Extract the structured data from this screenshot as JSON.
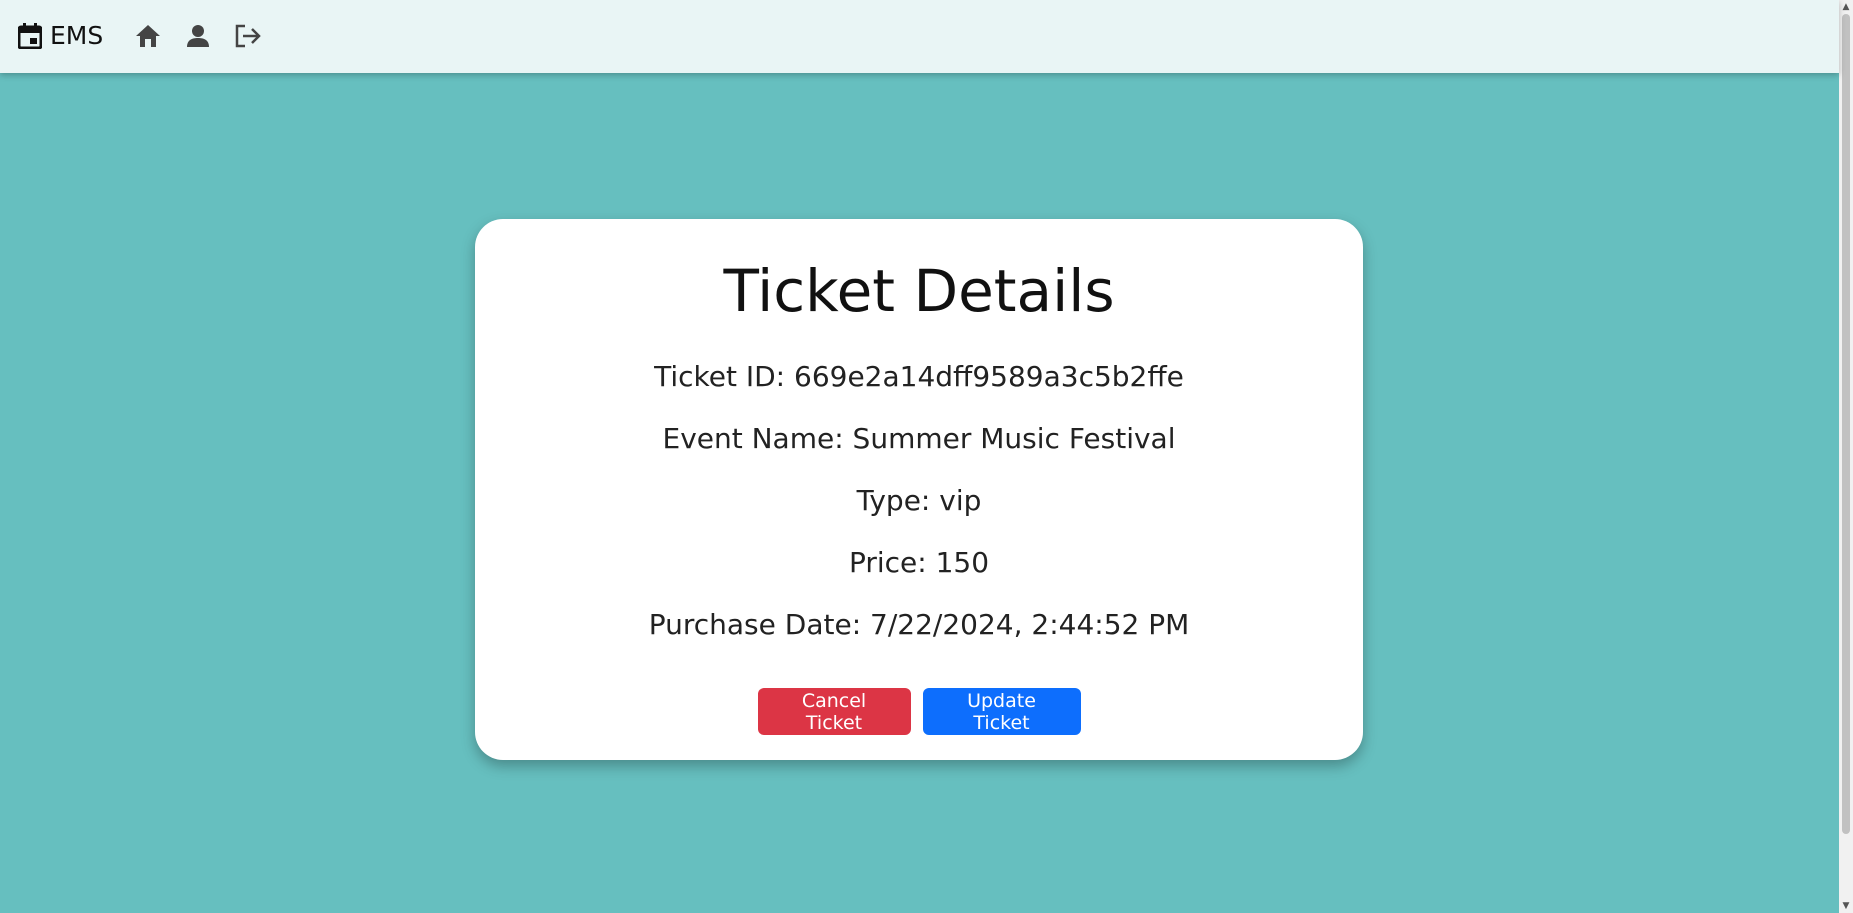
{
  "navbar": {
    "brand_text": "EMS",
    "brand_icon": "calendar-icon",
    "icons": [
      "home-icon",
      "user-icon",
      "logout-icon"
    ]
  },
  "card": {
    "title": "Ticket Details",
    "ticket_id": "Ticket ID: 669e2a14dff9589a3c5b2ffe",
    "event_name": "Event Name: Summer Music Festival",
    "type": "Type: vip",
    "price": "Price: 150",
    "purchase_date": "Purchase Date: 7/22/2024, 2:44:52 PM",
    "cancel_label": "Cancel Ticket",
    "update_label": "Update Ticket"
  },
  "colors": {
    "background": "#66bfbf",
    "navbar": "#e9f5f5",
    "cancel_button": "#dc3545",
    "update_button": "#0d6efd",
    "card": "#ffffff"
  }
}
